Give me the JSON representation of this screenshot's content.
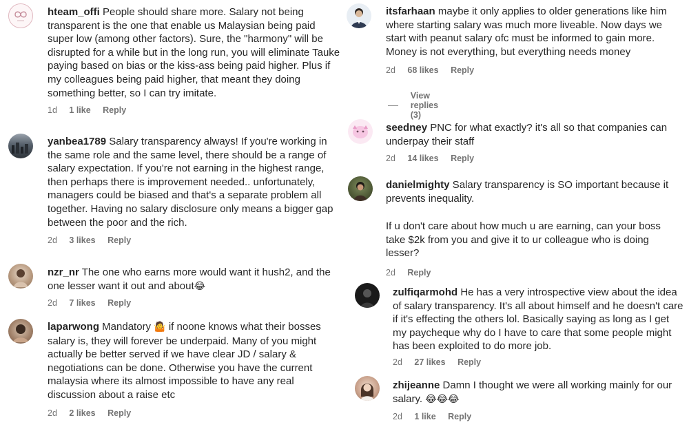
{
  "comments": [
    {
      "username": "hteam_offi",
      "text": " People should share more. Salary not being transparent is the one that enable us Malaysian being paid super low (among other factors). Sure, the \"harmony\" will be disrupted for a while but in the long run, you will eliminate Tauke paying based on bias or the kiss-ass being paid higher. Plus if my colleagues being paid higher, that meant they doing something better, so I can try imitate.",
      "time": "1d",
      "likes": "1 like",
      "reply": "Reply"
    },
    {
      "username": "yanbea1789",
      "text": " Salary transparency always! If you're working in the same role and the same level, there should be a range of salary expectation. If you're not earning in the highest range, then perhaps there is improvement needed.. unfortunately, managers could be biased and that's a separate problem all together. Having no salary disclosure only means a bigger gap between the poor and the rich.",
      "time": "2d",
      "likes": "3 likes",
      "reply": "Reply"
    },
    {
      "username": "nzr_nr",
      "text": " The one who earns more would want it hush2, and the one lesser want it out and about",
      "emoji": "😂",
      "time": "2d",
      "likes": "7 likes",
      "reply": "Reply"
    },
    {
      "username": "laparwong",
      "text_a": " Mandatory ",
      "emoji": "🤷",
      "text_b": " if noone knows what their bosses salary is, they will forever be underpaid. Many of you might actually be better served if we have clear JD / salary & negotiations can be done. Otherwise you have the current malaysia where its almost impossible to have any real discussion about a raise etc",
      "time": "2d",
      "likes": "2 likes",
      "reply": "Reply"
    },
    {
      "username": "itsfarhaan",
      "text": " maybe it only applies to older generations like him where starting salary was much more liveable. Now days we start with peanut salary ofc must be informed to gain more. Money is not everything, but everything needs money",
      "time": "2d",
      "likes": "68 likes",
      "reply": "Reply",
      "view_replies": "View replies (3)"
    },
    {
      "username": "seedney",
      "text": " PNC for what exactly? it's all so that companies can underpay their staff",
      "time": "2d",
      "likes": "14 likes",
      "reply": "Reply"
    },
    {
      "username": "danielmighty",
      "text": " Salary transparency is SO important because it prevents inequality.",
      "text_2": "If u don't care about how much u are earning, can your boss take $2k from you and give it to ur colleague who is doing lesser?",
      "time": "2d",
      "reply": "Reply"
    },
    {
      "username": "zulfiqarmohd",
      "text": " He has a very introspective view about the idea of salary transparency. It's all about himself and he doesn't care if it's effecting the others lol. Basically saying as long as I get my paycheque why do I have to care that some people might has been exploited to do more job.",
      "time": "2d",
      "likes": "27 likes",
      "reply": "Reply"
    },
    {
      "username": "zhijeanne",
      "text": " Damn I thought we were all working mainly for our salary. ",
      "emoji": "😂😂😂",
      "time": "2d",
      "likes": "1 like",
      "reply": "Reply"
    }
  ]
}
